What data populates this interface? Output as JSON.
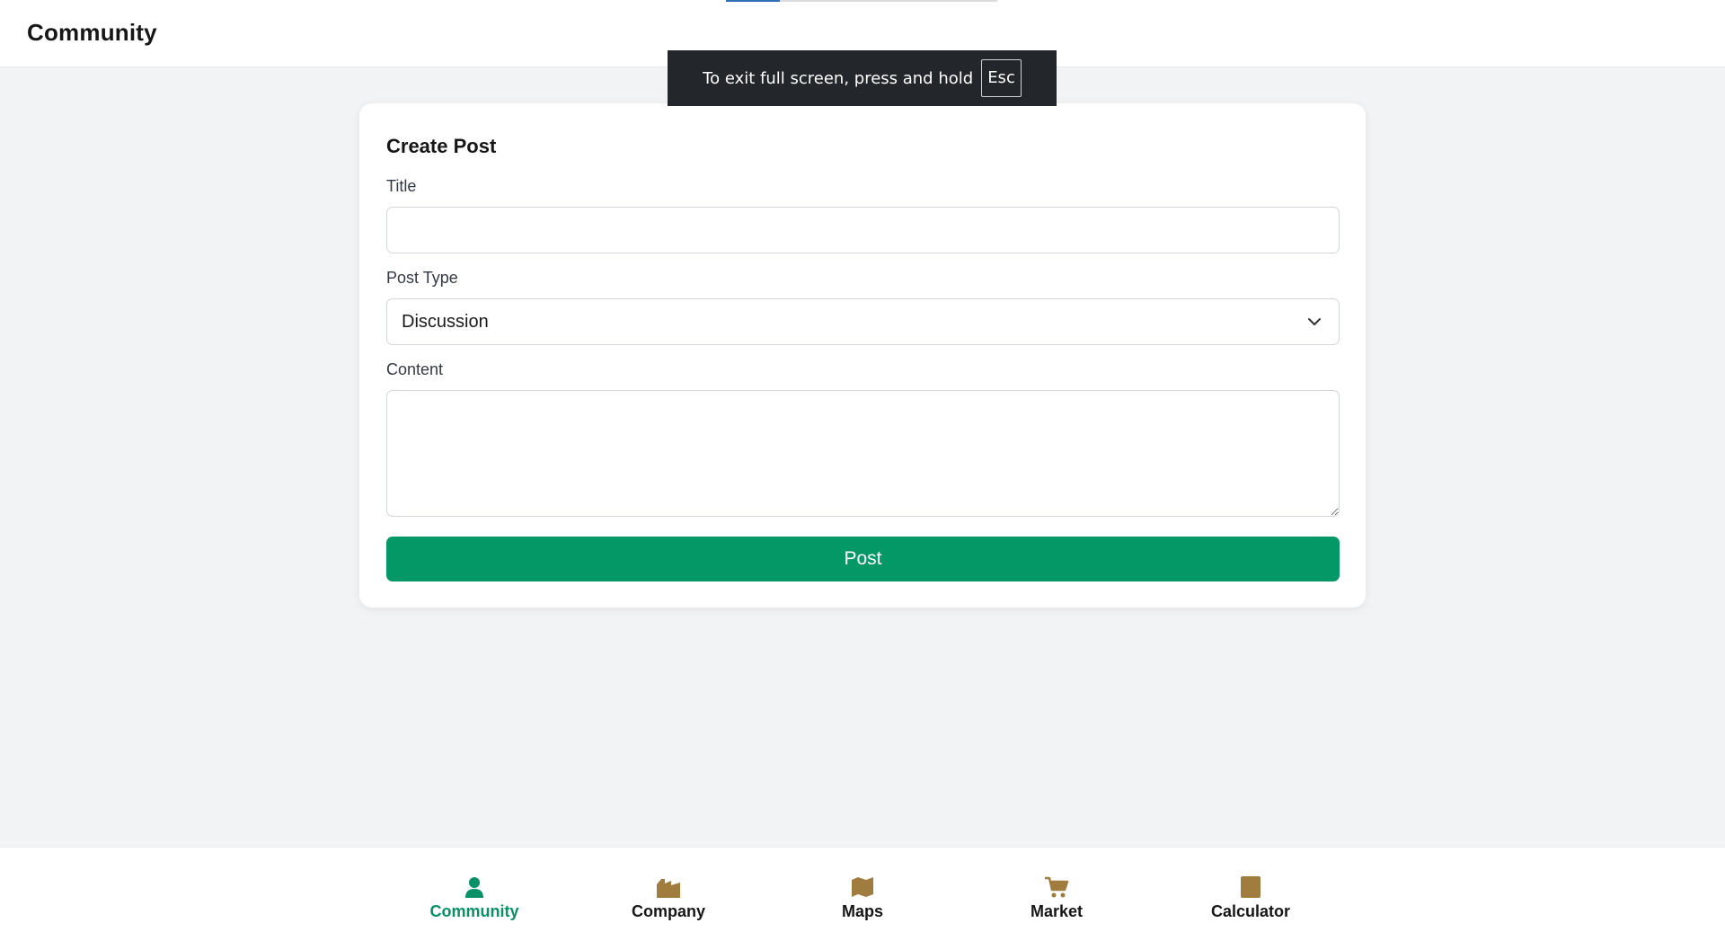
{
  "header": {
    "title": "Community",
    "load_progress": 0.2
  },
  "fullscreen_notice": {
    "message": "To exit full screen, press and hold",
    "key": "Esc"
  },
  "form": {
    "heading": "Create Post",
    "title_label": "Title",
    "title_value": "",
    "post_type_label": "Post Type",
    "post_type_value": "Discussion",
    "content_label": "Content",
    "content_value": "",
    "submit_label": "Post"
  },
  "colors": {
    "accent": "#049866",
    "active_nav": "#079164",
    "nav_icon": "#a07d3f",
    "toast_bg": "#23262b"
  },
  "bottom_nav": {
    "items": [
      {
        "label": "Community",
        "icon": "person-icon",
        "active": true
      },
      {
        "label": "Company",
        "icon": "factory-icon",
        "active": false
      },
      {
        "label": "Maps",
        "icon": "map-icon",
        "active": false
      },
      {
        "label": "Market",
        "icon": "cart-icon",
        "active": false
      },
      {
        "label": "Calculator",
        "icon": "calculator-icon",
        "active": false
      }
    ]
  }
}
